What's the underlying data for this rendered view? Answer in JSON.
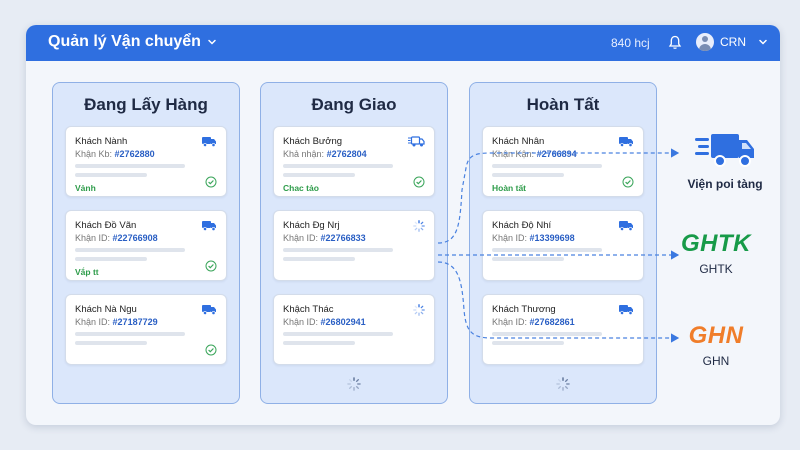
{
  "header": {
    "title": "Quản lý Vận chuyển",
    "count": "840 hcj",
    "user": "CRN"
  },
  "columns": [
    {
      "title": "Đang Lấy Hàng",
      "cards": [
        {
          "name": "Khách Nành",
          "id_label": "Khận Kb:",
          "id_value": "#2762880",
          "status": "Vảnh",
          "icon": "truck-icon",
          "mark": "check-icon"
        },
        {
          "name": "Khách Đồ Vãn",
          "id_label": "Khận ID:",
          "id_value": "#22766908",
          "status": "Vắp tt",
          "icon": "truck-icon",
          "mark": "check-icon"
        },
        {
          "name": "Khách Nà Ngu",
          "id_label": "Khận ID:",
          "id_value": "#27187729",
          "status": "",
          "icon": "truck-icon",
          "mark": "check-icon"
        }
      ]
    },
    {
      "title": "Đang Giao",
      "cards": [
        {
          "name": "Khách Bưởng",
          "id_label": "Khả nhận:",
          "id_value": "#2762804",
          "status": "Chac tảo",
          "icon": "moving-truck-icon",
          "mark": "check-icon"
        },
        {
          "name": "Khách Đg Nrj",
          "id_label": "Khận ID:",
          "id_value": "#22766833",
          "status": "",
          "icon": "spinner-icon",
          "mark": ""
        },
        {
          "name": "Khậch Thác",
          "id_label": "Khận ID:",
          "id_value": "#26802941",
          "status": "",
          "icon": "spinner-icon",
          "mark": ""
        }
      ]
    },
    {
      "title": "Hoàn Tất",
      "cards": [
        {
          "name": "Khách Nhân",
          "id_label": "Khận Kận:",
          "id_value": "#2766894",
          "status": "Hoàn tất",
          "icon": "truck-icon",
          "mark": "check-icon"
        },
        {
          "name": "Khách Độ Nhí",
          "id_label": "Khận ID:",
          "id_value": "#13399698",
          "status": "",
          "icon": "truck-icon",
          "mark": ""
        },
        {
          "name": "Khách Thương",
          "id_label": "Khận ID:",
          "id_value": "#27682861",
          "status": "",
          "icon": "truck-icon",
          "mark": ""
        }
      ]
    }
  ],
  "destinations": [
    {
      "label": "Viện poi tàng",
      "icon": "delivery-truck-icon"
    },
    {
      "logo": "GHTK",
      "label": "GHTK"
    },
    {
      "logo": "GHN",
      "label": "GHN"
    }
  ],
  "colors": {
    "header": "#2f6fe0",
    "column_bg": "#dbe7fb",
    "id_blue": "#2a5fc4",
    "status_green": "#2e9c4a",
    "ghtk_green": "#179a48",
    "ghn_orange": "#f07d2a"
  }
}
